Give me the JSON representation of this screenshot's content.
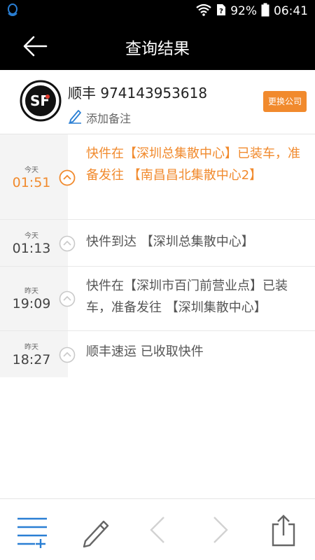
{
  "status_bar": {
    "battery": "92%",
    "time": "06:41",
    "icons": [
      "qq-icon",
      "wifi-icon",
      "sim-icon",
      "battery-icon"
    ]
  },
  "app_bar": {
    "title": "查询结果",
    "back_icon": "back-arrow-icon"
  },
  "company": {
    "name": "顺丰 974143953618",
    "logo_text": "SF",
    "note_label": "添加备注",
    "switch_label": "更换公司"
  },
  "timeline": [
    {
      "day": "今天",
      "time": "01:51",
      "text": "快件在【深圳总集散中心】已装车，准备发往 【南昌昌北集散中心2】",
      "active": true
    },
    {
      "day": "今天",
      "time": "01:13",
      "text": "快件到达 【深圳总集散中心】",
      "active": false
    },
    {
      "day": "昨天",
      "time": "19:09",
      "text": "快件在【深圳市百门前营业点】已装车，准备发往 【深圳集散中心】",
      "active": false
    },
    {
      "day": "昨天",
      "time": "18:27",
      "text": "顺丰速运 已收取快件",
      "active": false
    }
  ],
  "toolbar": {
    "items": [
      "list-add-icon",
      "pencil-icon",
      "chevron-left-icon",
      "chevron-right-icon",
      "share-icon"
    ]
  },
  "colors": {
    "accent": "#f18a2d",
    "icon_blue": "#2a7fd4",
    "bar_black": "#000000"
  }
}
